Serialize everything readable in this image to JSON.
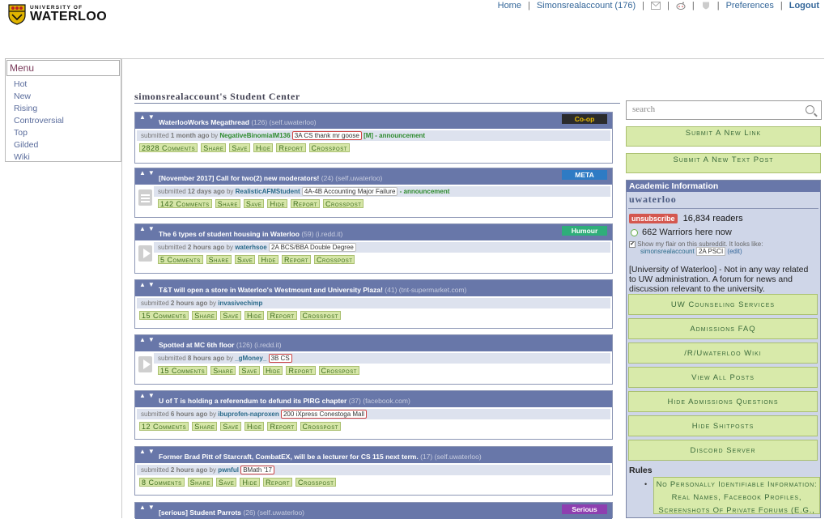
{
  "header": {
    "logo_small": "UNIVERSITY OF",
    "logo_big": "WATERLOO",
    "nav": {
      "home": "Home",
      "user": "Simonsrealaccount (176)",
      "preferences": "Preferences",
      "logout": "Logout"
    }
  },
  "menu": {
    "title": "Menu",
    "items": [
      "Hot",
      "New",
      "Rising",
      "Controversial",
      "Top",
      "Gilded",
      "Wiki"
    ]
  },
  "page_title": "simonsrealaccount's Student Center",
  "posts": [
    {
      "title": "WaterlooWorks Megathread",
      "comments_count": "(126)",
      "domain": "(self.uwaterloo)",
      "tag": "Co-op",
      "tag_color": "#2b2b2b",
      "tag_text_color": "#f0c000",
      "time": "1 month ago",
      "author": "NegativeBinomialM136",
      "flair": "3A CS thank mr goose",
      "mod": "[M]",
      "extra": " - announcement",
      "comments_label": "2828 Comments"
    },
    {
      "title": "[November 2017] Call for two(2) new moderators!",
      "comments_count": "(24)",
      "domain": "(self.uwaterloo)",
      "tag": "META",
      "tag_color": "#2e7bc4",
      "tag_text_color": "#ffffff",
      "time": "12 days ago",
      "author": "RealisticAFMStudent",
      "flair": "4A-4B Accounting Major Failure",
      "extra": " - announcement",
      "comments_label": "142 Comments"
    },
    {
      "title": "The 6 types of student housing in Waterloo",
      "comments_count": "(59)",
      "domain": "(i.redd.it)",
      "tag": "Humour",
      "tag_color": "#2fae7a",
      "tag_text_color": "#ffffff",
      "time": "2 hours ago",
      "author": "waterhsoe",
      "flair": "2A BCS/BBA Double Degree",
      "comments_label": "5 Comments"
    },
    {
      "title": "T&T will open a store in Waterloo's Westmount and University Plaza!",
      "comments_count": "(41)",
      "domain": "(tnt-supermarket.com)",
      "time": "2 hours ago",
      "author": "invasivechimp",
      "comments_label": "15 Comments"
    },
    {
      "title": "Spotted at MC 6th floor",
      "comments_count": "(126)",
      "domain": "(i.redd.it)",
      "time": "8 hours ago",
      "author": "_gMoney_",
      "flair": "3B CS",
      "comments_label": "15 Comments"
    },
    {
      "title": "U of T is holding a referendum to defund its PIRG chapter",
      "comments_count": "(37)",
      "domain": "(facebook.com)",
      "time": "6 hours ago",
      "author": "ibuprofen-naproxen",
      "flair": "200 iXpress Conestoga Mall",
      "comments_label": "12 Comments"
    },
    {
      "title": "Former Brad Pitt of Starcraft, CombatEX, will be a lecturer for CS 115 next term.",
      "comments_count": "(17)",
      "domain": "(self.uwaterloo)",
      "time": "2 hours ago",
      "author": "pwnful",
      "flair": "BMath '17",
      "comments_label": "8 Comments"
    },
    {
      "title": "[serious] Student Parrots",
      "comments_count": "(26)",
      "domain": "(self.uwaterloo)",
      "tag": "Serious",
      "tag_color": "#8e3fb0",
      "tag_text_color": "#ffffff"
    }
  ],
  "post_labels": {
    "submitted": "submitted",
    "by": "by",
    "share": "Share",
    "save": "Save",
    "hide": "Hide",
    "report": "Report",
    "crosspost": "Crosspost"
  },
  "sidebar": {
    "search_placeholder": "search",
    "submit_link": "Submit A New Link",
    "submit_text": "Submit A New Text Post",
    "academic_title": "Academic Information",
    "subreddit_name": "uwaterloo",
    "subscribe_label": "unsubscribe",
    "readers": "16,834 readers",
    "online": "662 Warriors here now",
    "flair_note": "Show my flair on this subreddit. It looks like:",
    "flair_user": "simonsrealaccount",
    "flair_tag": "2A PSCI",
    "flair_edit": "(edit)",
    "description": "[University of Waterloo] - Not in any way related to UW administration. A forum for news and discussion relevant to the university.",
    "links": [
      "UW Counseling Services",
      "Admissions FAQ",
      "/R/Uwaterloo Wiki",
      "View All Posts",
      "Hide Admissions Questions",
      "Hide Shitposts",
      "Discord Server"
    ],
    "rules_title": "Rules",
    "rule_1": "No Personally Identifiable Information: Real Names, Facebook Profiles, Screenshots Of Private Forums (E.G.,"
  },
  "colors": {
    "post_header": "#6877a9",
    "button_green": "#d8eaaa",
    "unsubscribe": "#d4574f"
  }
}
